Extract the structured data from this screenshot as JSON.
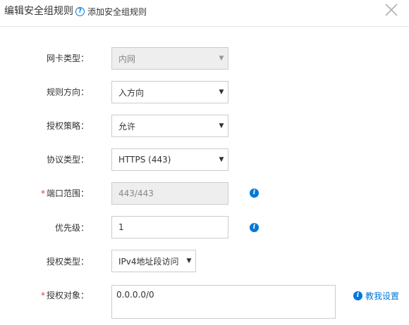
{
  "header": {
    "title": "编辑安全组规则",
    "help_icon": "question-circle-icon",
    "help_text": "添加安全组规则",
    "close_icon": "close-icon"
  },
  "form": {
    "nic_type": {
      "label": "网卡类型：",
      "value": "内网",
      "disabled": true
    },
    "direction": {
      "label": "规则方向：",
      "value": "入方向"
    },
    "policy": {
      "label": "授权策略：",
      "value": "允许"
    },
    "protocol": {
      "label": "协议类型：",
      "value": "HTTPS (443)"
    },
    "port_range": {
      "required_mark": "*",
      "label": "端口范围：",
      "value": "443/443",
      "disabled": true,
      "info_icon": "info-icon"
    },
    "priority": {
      "label": "优先级：",
      "value": "1",
      "info_icon": "info-icon"
    },
    "auth_type": {
      "label": "授权类型：",
      "value": "IPv4地址段访问"
    },
    "auth_object": {
      "required_mark": "*",
      "label": "授权对象：",
      "value": "0.0.0.0/0"
    }
  },
  "tutorial_link": {
    "icon": "info-icon",
    "text": "教我设置"
  },
  "colors": {
    "accent": "#0078d7",
    "required": "#e4393c",
    "border": "#cccccc",
    "disabled_bg": "#eeeeee"
  }
}
